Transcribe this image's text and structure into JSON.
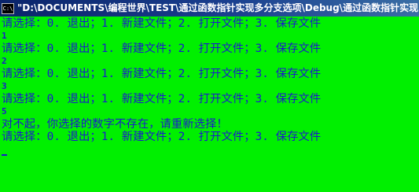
{
  "window": {
    "title": "\"D:\\DOCUMENTS\\编程世界\\TEST\\通过函数指针实现多分支选项\\Debug\\通过函数指针实现",
    "icon_label": "C:\\"
  },
  "console": {
    "lines": [
      {
        "kind": "prompt",
        "text": "请选择：0. 退出；1. 新建文件；2. 打开文件；3. 保存文件"
      },
      {
        "kind": "input",
        "text": "1"
      },
      {
        "kind": "prompt",
        "text": "请选择：0. 退出；1. 新建文件；2. 打开文件；3. 保存文件"
      },
      {
        "kind": "input",
        "text": "2"
      },
      {
        "kind": "prompt",
        "text": "请选择：0. 退出；1. 新建文件；2. 打开文件；3. 保存文件"
      },
      {
        "kind": "input",
        "text": "3"
      },
      {
        "kind": "prompt",
        "text": "请选择：0. 退出；1. 新建文件；2. 打开文件；3. 保存文件"
      },
      {
        "kind": "input",
        "text": "5"
      },
      {
        "kind": "message",
        "text": "对不起，你选择的数字不存在，请重新选择！"
      },
      {
        "kind": "prompt",
        "text": "请选择：0. 退出；1. 新建文件；2. 打开文件；3. 保存文件"
      }
    ]
  },
  "colors": {
    "background": "#00f000",
    "text": "#1a1acc",
    "titlebar": "#0a246a"
  }
}
